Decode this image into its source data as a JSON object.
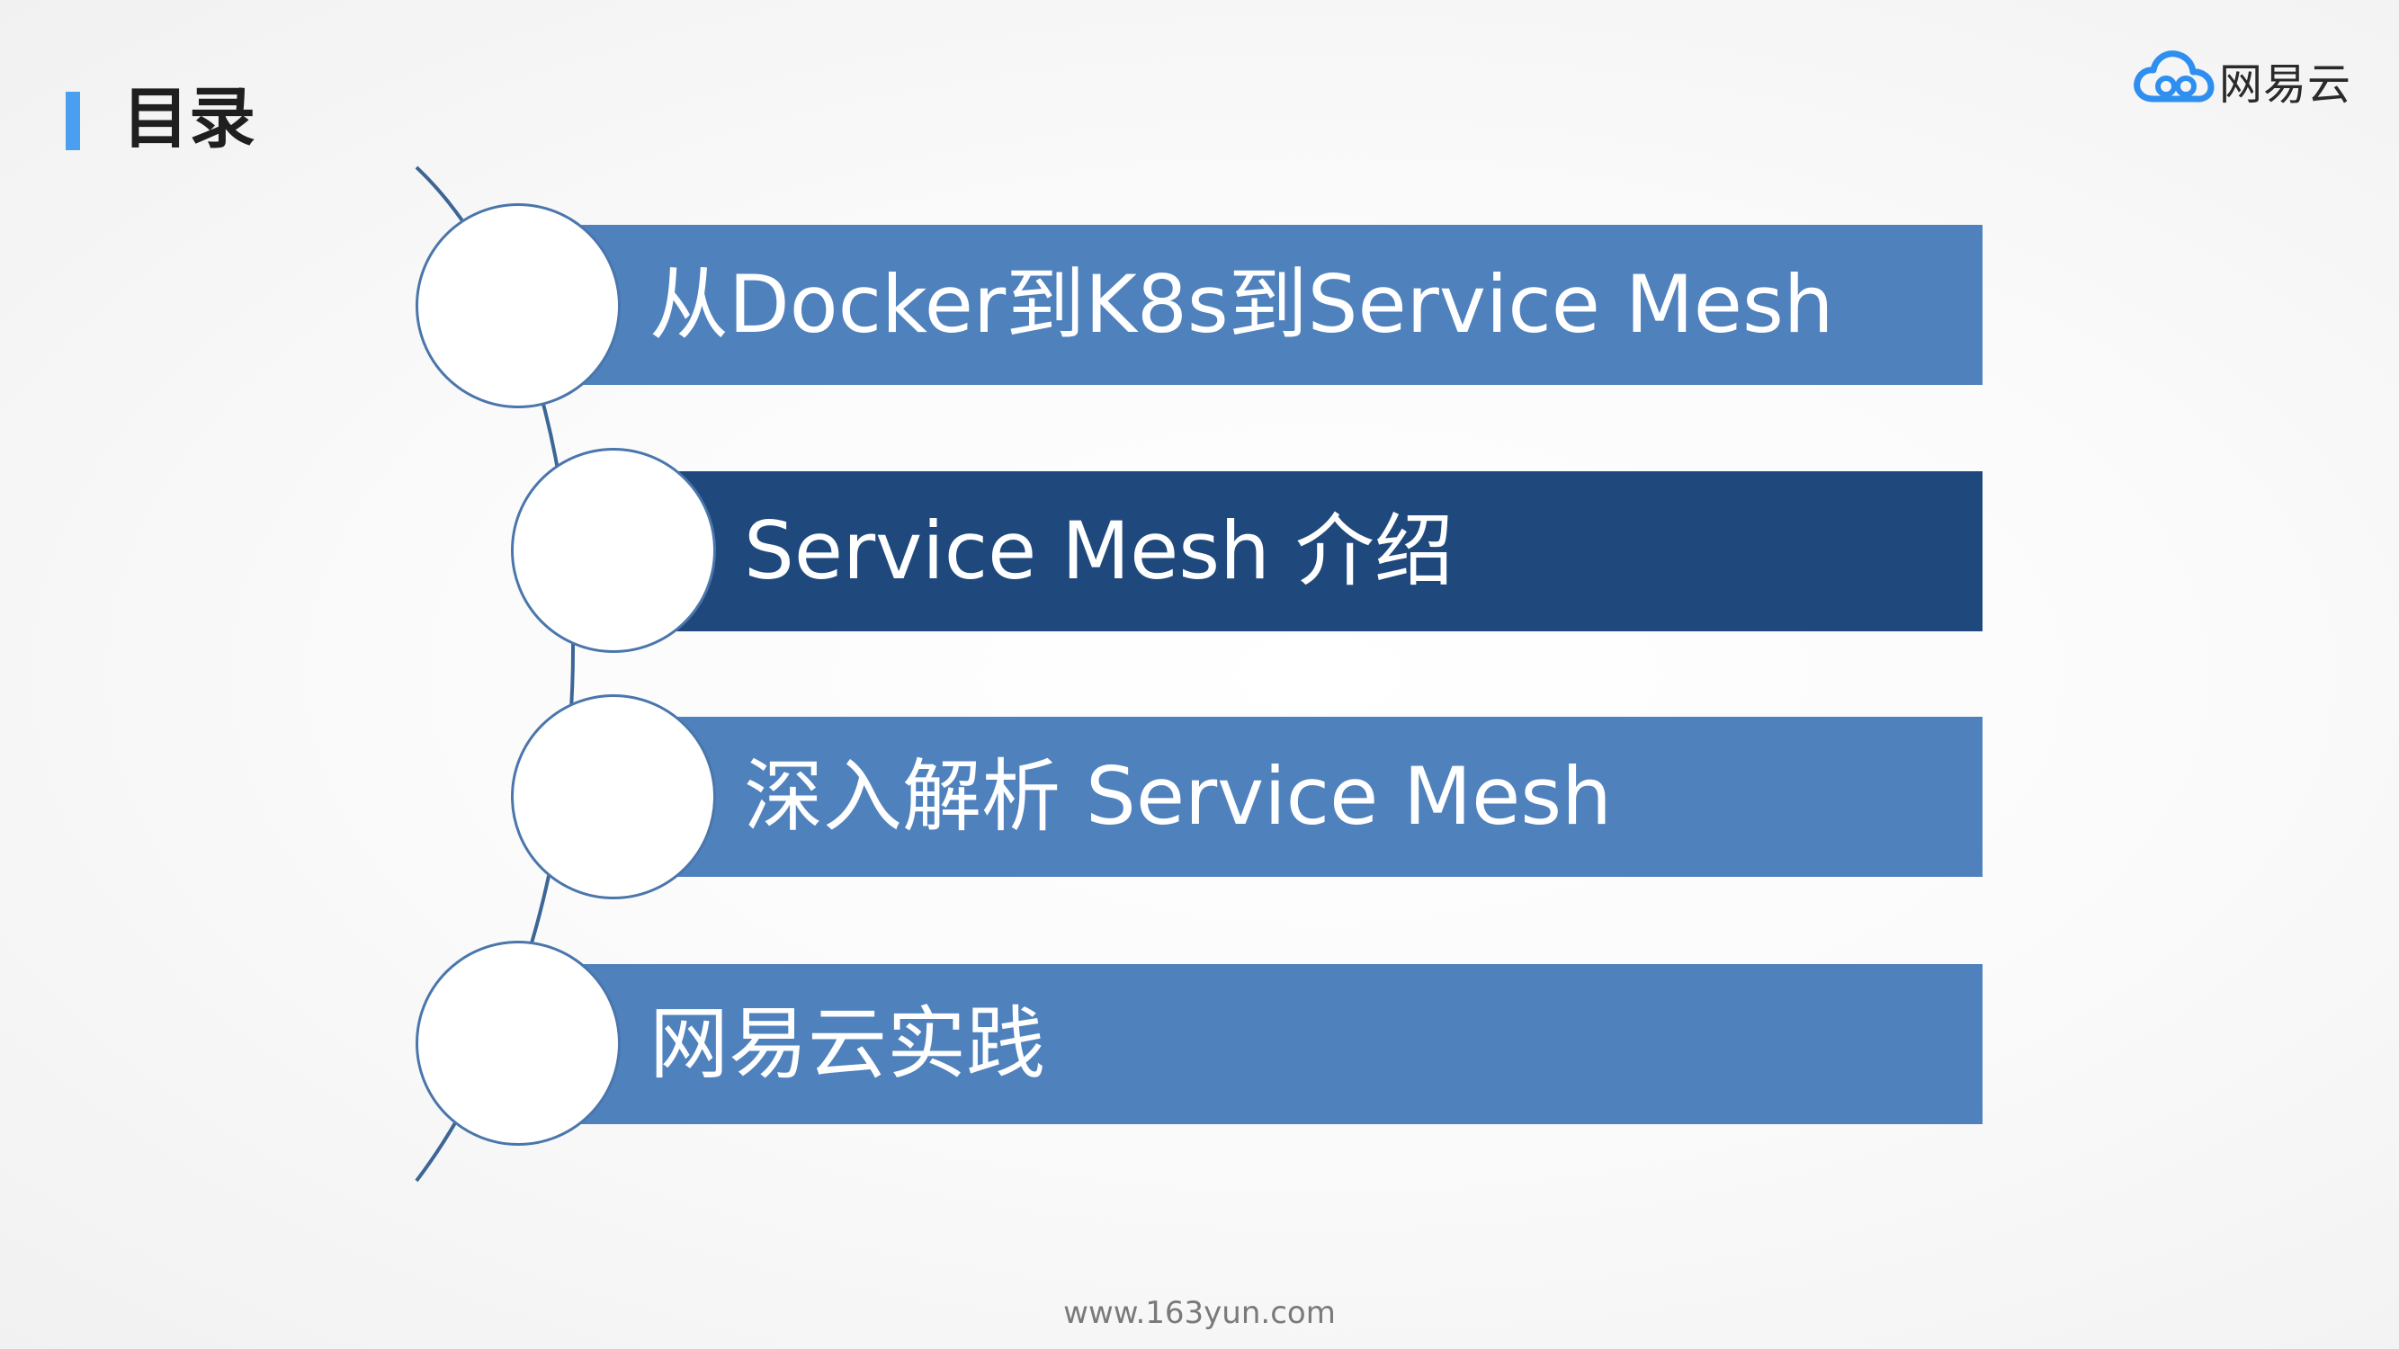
{
  "page": {
    "title": "目录",
    "footer": "www.163yun.com"
  },
  "logo": {
    "text": "网易云",
    "icon": "cloud-icon",
    "color": "#2f8ff0"
  },
  "colors": {
    "accent": "#4a9ff0",
    "bar": "#4f81bd",
    "bar_active": "#1f497d"
  },
  "toc": {
    "items": [
      {
        "label": "从Docker到K8s到Service Mesh",
        "active": false
      },
      {
        "label": "Service Mesh 介绍",
        "active": true
      },
      {
        "label": "深入解析 Service Mesh",
        "active": false
      },
      {
        "label": "网易云实践",
        "active": false
      }
    ]
  }
}
